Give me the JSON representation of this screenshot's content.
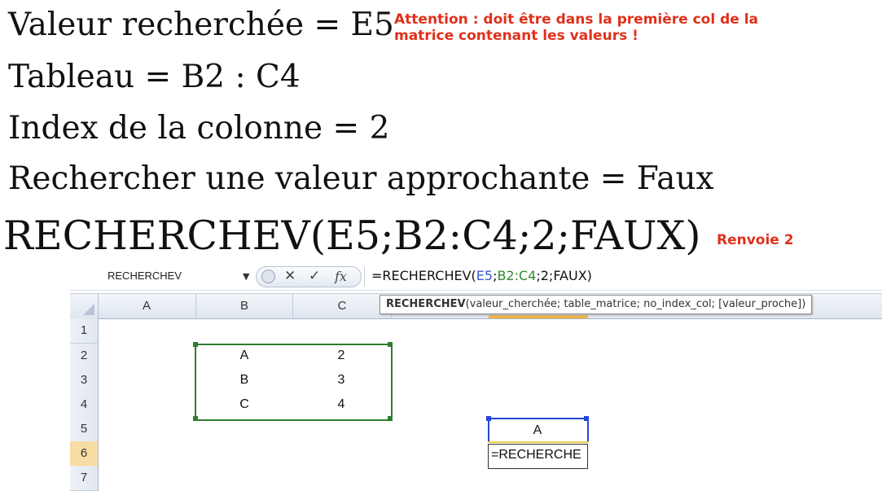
{
  "slide": {
    "line1": "Valeur recherchée = E5",
    "line2": "Tableau = B2 : C4",
    "line3": "Index de la colonne = 2",
    "line4": "Rechercher une valeur approchante = Faux",
    "formula": "RECHERCHEV(E5;B2:C4;2;FAUX)",
    "note_attention": "Attention : doit être dans la première col de la matrice contenant les valeurs !",
    "note_result": "Renvoie 2"
  },
  "excel": {
    "name_box": "RECHERCHEV",
    "formula_bar": {
      "prefix": "=RECHERCHEV(",
      "ref1": "E5",
      "sep1": ";",
      "ref2": "B2:C4",
      "rest": ";2;FAUX)"
    },
    "tooltip": {
      "function": "RECHERCHEV",
      "args": "(valeur_cherchée; table_matrice; no_index_col; [valeur_proche])"
    },
    "column_headers": [
      "A",
      "B",
      "C"
    ],
    "row_headers": [
      "1",
      "2",
      "3",
      "4",
      "5",
      "6",
      "7"
    ],
    "cells": {
      "B2": "A",
      "C2": "2",
      "B3": "B",
      "C3": "3",
      "B4": "C",
      "C4": "4",
      "E5": "A",
      "E6": "=RECHERCHE"
    },
    "colors": {
      "ref_blue": "#3559d4",
      "ref_green": "#2e8a2b",
      "note_red": "#e0311b"
    },
    "icons": [
      "dropdown-arrow-icon",
      "cancel-icon",
      "enter-icon",
      "insert-function-icon"
    ]
  }
}
